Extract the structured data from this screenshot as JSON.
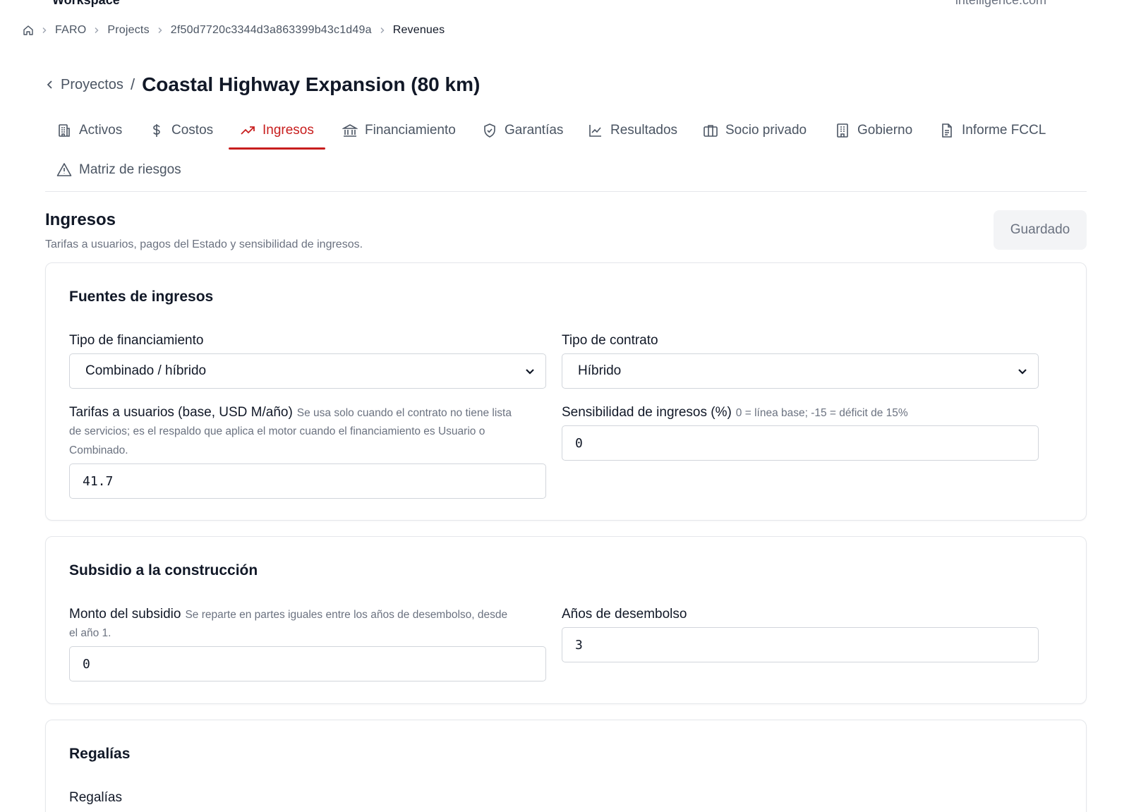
{
  "topbar": {
    "left": "Workspace",
    "right": "intelligence.com"
  },
  "breadcrumb": {
    "items": [
      "FARO",
      "Projects",
      "2f50d7720c3344d3a863399b43c1d49a"
    ],
    "current": "Revenues"
  },
  "project": {
    "back_label": "Proyectos",
    "title": "Coastal Highway Expansion (80 km)"
  },
  "tabs": [
    {
      "label": "Activos",
      "icon": "building-icon"
    },
    {
      "label": "Costos",
      "icon": "dollar-icon"
    },
    {
      "label": "Ingresos",
      "icon": "trending-up-icon",
      "active": true
    },
    {
      "label": "Financiamiento",
      "icon": "bank-icon"
    },
    {
      "label": "Garantías",
      "icon": "shield-icon"
    },
    {
      "label": "Resultados",
      "icon": "line-chart-icon"
    },
    {
      "label": "Socio privado",
      "icon": "briefcase-icon"
    },
    {
      "label": "Gobierno",
      "icon": "office-building-icon"
    },
    {
      "label": "Informe FCCL",
      "icon": "document-icon"
    },
    {
      "label": "Matriz de riesgos",
      "icon": "warning-icon"
    }
  ],
  "section": {
    "title": "Ingresos",
    "description": "Tarifas a usuarios, pagos del Estado y sensibilidad de ingresos.",
    "save_label": "Guardado"
  },
  "revenue_sources": {
    "title": "Fuentes de ingresos",
    "funding_type": {
      "label": "Tipo de financiamiento",
      "value": "Combinado / híbrido"
    },
    "contract_type": {
      "label": "Tipo de contrato",
      "value": "Híbrido"
    },
    "user_fees": {
      "label": "Tarifas a usuarios (base, USD M/año)",
      "hint_line1": "Se usa solo cuando el contrato no tiene lista",
      "hint_line2": "de servicios; es el respaldo que aplica el motor cuando el financiamiento es Usuario o",
      "hint_line3": "Combinado.",
      "value": "41.7"
    },
    "sensitivity": {
      "label": "Sensibilidad de ingresos (%)",
      "hint": "0 = línea base; -15 = déficit de 15%",
      "value": "0"
    }
  },
  "construction_subsidy": {
    "title": "Subsidio a la construcción",
    "amount": {
      "label": "Monto del subsidio",
      "hint_line1": "Se reparte en partes iguales entre los años de desembolso, desde",
      "hint_line2": "el año 1.",
      "value": "0"
    },
    "years": {
      "label": "Años de desembolso",
      "value": "3"
    }
  },
  "royalties": {
    "title": "Regalías",
    "field_label": "Regalías"
  },
  "colors": {
    "accent": "#c81e1e",
    "muted": "#6b7280",
    "border": "#e5e7eb"
  }
}
